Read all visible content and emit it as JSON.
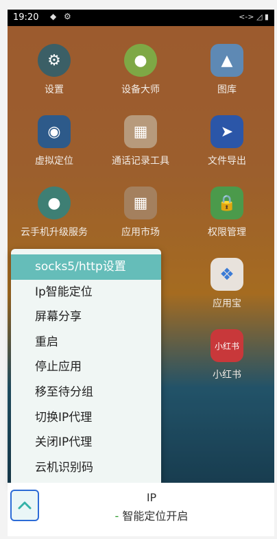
{
  "status": {
    "time": "19:20",
    "right": "<-> ◿ ▮"
  },
  "apps": [
    {
      "label": "设置",
      "icon": "gear-icon"
    },
    {
      "label": "设备大师",
      "icon": "android-icon"
    },
    {
      "label": "图库",
      "icon": "gallery-icon"
    },
    {
      "label": "虚拟定位",
      "icon": "location-icon"
    },
    {
      "label": "通话记录工具",
      "icon": "call-log-icon"
    },
    {
      "label": "文件导出",
      "icon": "file-export-icon"
    },
    {
      "label": "云手机升级服务",
      "icon": "android-icon"
    },
    {
      "label": "应用市场",
      "icon": "app-market-icon"
    },
    {
      "label": "权限管理",
      "icon": "lock-icon"
    },
    {
      "label": "应用宝",
      "icon": "yingyongbao-icon"
    },
    {
      "label": "小红书",
      "icon": "xiaohongshu-icon"
    }
  ],
  "menu": {
    "items": [
      "socks5/http设置",
      "Ip智能定位",
      "屏幕分享",
      "重启",
      "停止应用",
      "移至待分组",
      "切换IP代理",
      "关闭IP代理",
      "云机识别码"
    ]
  },
  "bottom": {
    "ip_label": "IP",
    "dash": "-",
    "status_text": "智能定位开启"
  },
  "colors": {
    "menu_selected": "#65bdb9",
    "button_border": "#2c6bd6"
  }
}
